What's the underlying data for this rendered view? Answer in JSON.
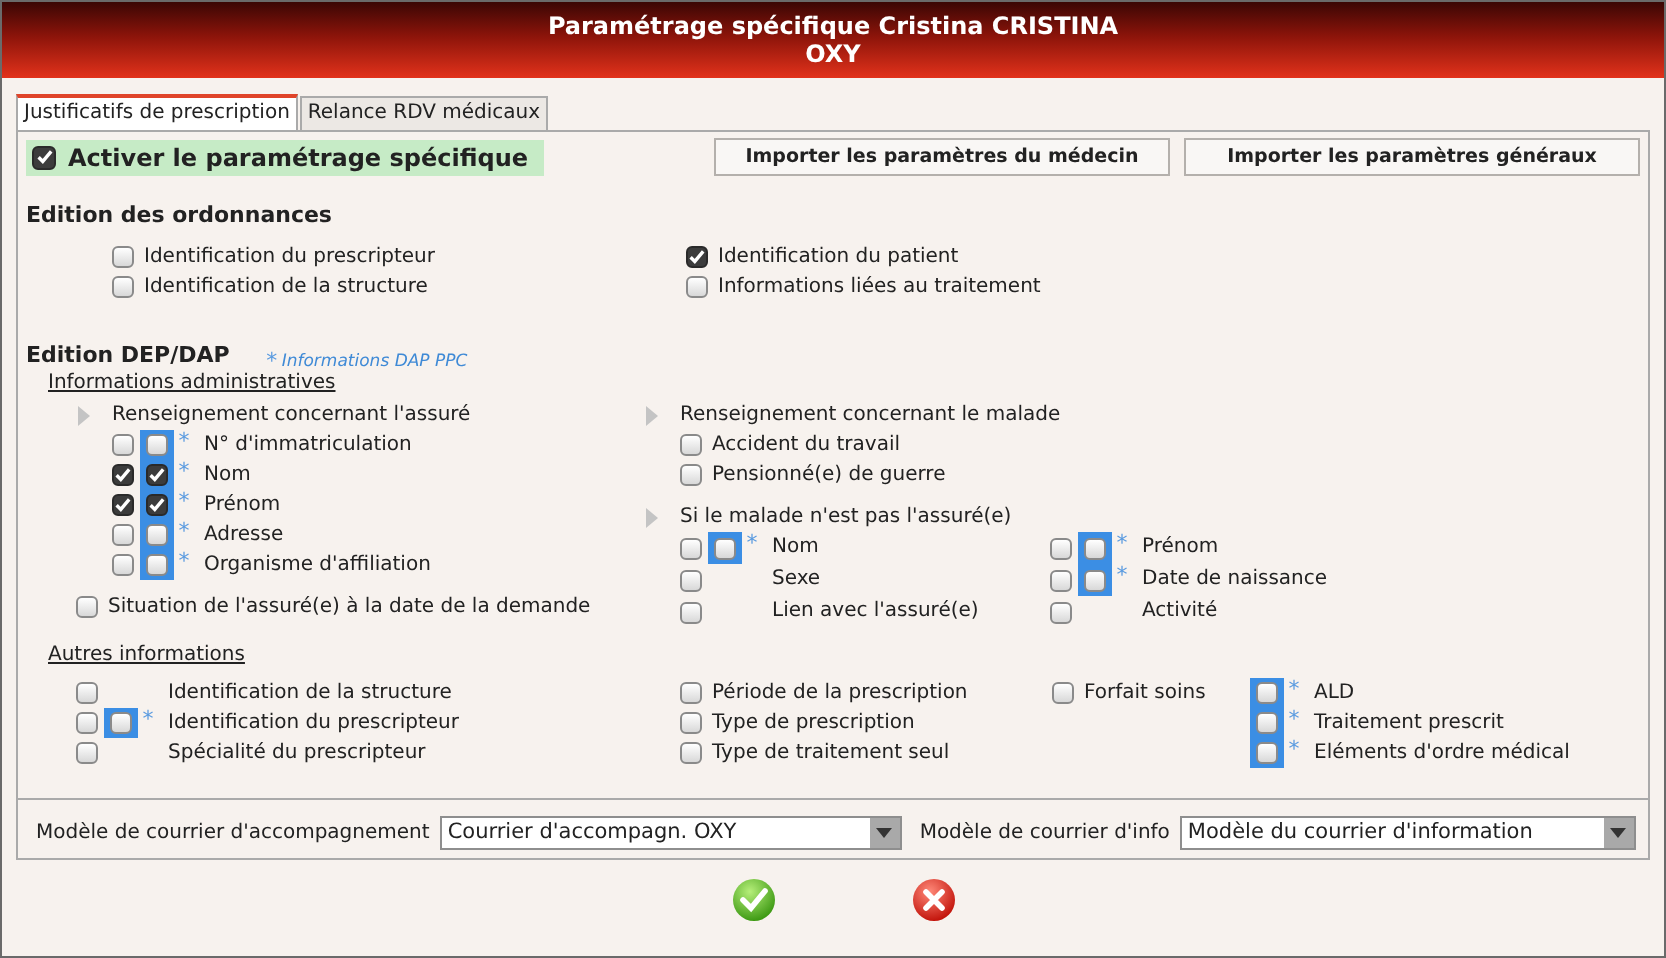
{
  "window": {
    "title_lines": [
      "Paramétrage spécifique Cristina CRISTINA",
      "OXY"
    ]
  },
  "tabs": [
    {
      "label": "Justificatifs de prescription",
      "selected": true
    },
    {
      "label": "Relance RDV médicaux",
      "selected": false
    }
  ],
  "activate": {
    "label": "Activer le paramétrage spécifique",
    "checked": true
  },
  "import_buttons": [
    "Importer les paramètres du médecin",
    "Importer les paramètres généraux"
  ],
  "ordonnances": {
    "title": "Edition des ordonnances",
    "columns": [
      [
        {
          "kind": "plain",
          "label": "Identification du prescripteur",
          "checked": false
        },
        {
          "kind": "plain",
          "label": "Identification de la structure",
          "checked": false
        }
      ],
      [
        {
          "kind": "plain",
          "label": "Identification du patient",
          "checked": true
        },
        {
          "kind": "plain",
          "label": "Informations liées au traitement",
          "checked": false
        }
      ]
    ]
  },
  "dep": {
    "title": "Edition DEP/DAP",
    "legend": {
      "star": "*",
      "text": "Informations DAP PPC"
    },
    "admin": {
      "title": "Informations administratives",
      "assure": {
        "title": "Renseignement concernant l'assuré",
        "rows": [
          {
            "kind": "double",
            "label": "N° d'immatriculation",
            "checked": false,
            "dap_checked": false,
            "star": "*"
          },
          {
            "kind": "double",
            "label": "Nom",
            "checked": true,
            "dap_checked": true,
            "star": "*"
          },
          {
            "kind": "double",
            "label": "Prénom",
            "checked": true,
            "dap_checked": true,
            "star": "*"
          },
          {
            "kind": "double",
            "label": "Adresse",
            "checked": false,
            "dap_checked": false,
            "star": "*"
          },
          {
            "kind": "double",
            "label": "Organisme d'affiliation",
            "checked": false,
            "dap_checked": false,
            "star": "*"
          }
        ]
      },
      "situation": {
        "kind": "plain",
        "label": "Situation de l'assuré(e) à la date de la demande",
        "checked": false
      },
      "malade": {
        "title": "Renseignement concernant le malade",
        "rows": [
          {
            "kind": "plain",
            "label": "Accident du travail",
            "checked": false
          },
          {
            "kind": "plain",
            "label": "Pensionné(e) de guerre",
            "checked": false
          }
        ]
      },
      "autre_malade": {
        "title": "Si le malade n'est pas l'assuré(e)",
        "columns": [
          [
            {
              "kind": "double",
              "label": "Nom",
              "checked": false,
              "dap_checked": false,
              "star": "*"
            },
            {
              "kind": "spaced",
              "label": "Sexe",
              "checked": false
            },
            {
              "kind": "spaced",
              "label": "Lien avec l'assuré(e)",
              "checked": false
            }
          ],
          [
            {
              "kind": "double",
              "label": "Prénom",
              "checked": false,
              "dap_checked": false,
              "star": "*"
            },
            {
              "kind": "double",
              "label": "Date de naissance",
              "checked": false,
              "dap_checked": false,
              "star": "*"
            },
            {
              "kind": "spaced",
              "label": "Activité",
              "checked": false
            }
          ]
        ]
      }
    },
    "autres": {
      "title": "Autres informations",
      "columns": [
        [
          {
            "kind": "spaced",
            "label": "Identification de la structure",
            "checked": false
          },
          {
            "kind": "double",
            "label": "Identification du prescripteur",
            "checked": false,
            "dap_checked": false,
            "star": "*"
          },
          {
            "kind": "spaced",
            "label": "Spécialité du prescripteur",
            "checked": false
          }
        ],
        [
          {
            "kind": "plain",
            "label": "Période de la prescription",
            "checked": false
          },
          {
            "kind": "plain",
            "label": "Type de prescription",
            "checked": false
          },
          {
            "kind": "plain",
            "label": "Type de traitement seul",
            "checked": false
          }
        ],
        [
          {
            "kind": "plain",
            "label": "Forfait soins",
            "checked": false
          }
        ],
        [
          {
            "kind": "dap",
            "label": "ALD",
            "dap_checked": false,
            "star": "*"
          },
          {
            "kind": "dap",
            "label": "Traitement prescrit",
            "dap_checked": false,
            "star": "*"
          },
          {
            "kind": "dap",
            "label": "Eléments d'ordre médical",
            "dap_checked": false,
            "star": "*"
          }
        ]
      ]
    }
  },
  "letters": [
    {
      "label": "Modèle de courrier d'accompagnement",
      "value": "Courrier d'accompagn. OXY"
    },
    {
      "label": "Modèle de courrier d'info",
      "value": "Modèle du courrier d'information"
    }
  ],
  "actions": [
    {
      "kind": "ok"
    },
    {
      "kind": "cancel"
    }
  ]
}
